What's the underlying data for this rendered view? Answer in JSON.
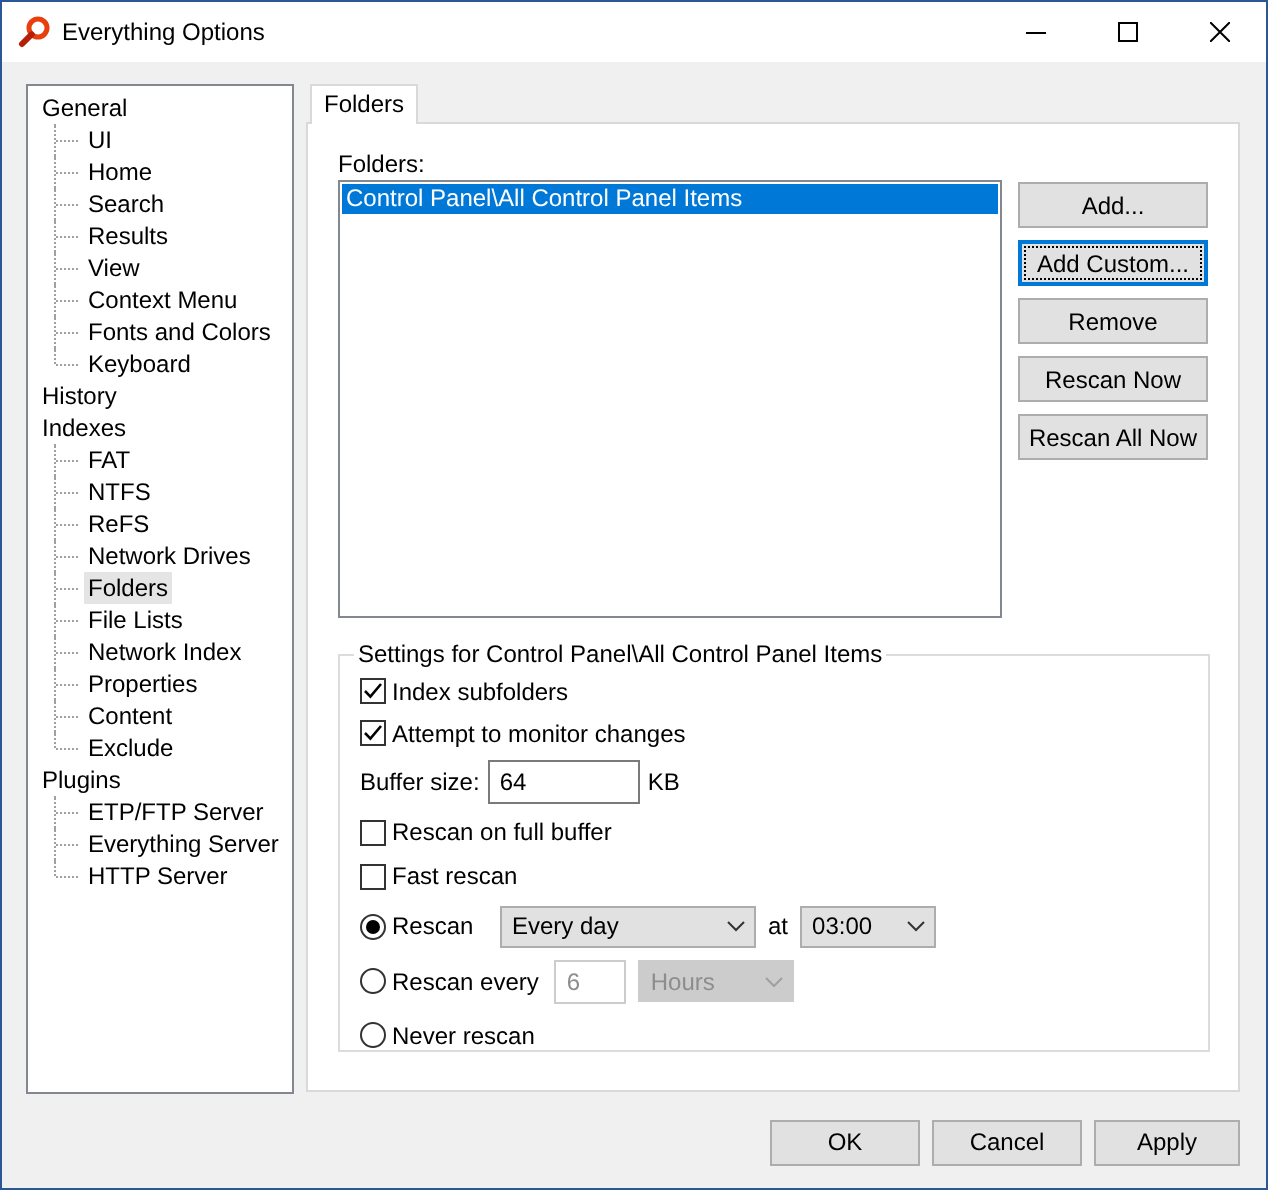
{
  "window": {
    "title": "Everything Options"
  },
  "sidebar": {
    "tree": [
      {
        "label": "General",
        "selected": false,
        "children": [
          {
            "label": "UI",
            "selected": false
          },
          {
            "label": "Home",
            "selected": false
          },
          {
            "label": "Search",
            "selected": false
          },
          {
            "label": "Results",
            "selected": false
          },
          {
            "label": "View",
            "selected": false
          },
          {
            "label": "Context Menu",
            "selected": false
          },
          {
            "label": "Fonts and Colors",
            "selected": false
          },
          {
            "label": "Keyboard",
            "selected": false
          }
        ]
      },
      {
        "label": "History",
        "selected": false
      },
      {
        "label": "Indexes",
        "selected": false,
        "children": [
          {
            "label": "FAT",
            "selected": false
          },
          {
            "label": "NTFS",
            "selected": false
          },
          {
            "label": "ReFS",
            "selected": false
          },
          {
            "label": "Network Drives",
            "selected": false
          },
          {
            "label": "Folders",
            "selected": true
          },
          {
            "label": "File Lists",
            "selected": false
          },
          {
            "label": "Network Index",
            "selected": false
          },
          {
            "label": "Properties",
            "selected": false
          },
          {
            "label": "Content",
            "selected": false
          },
          {
            "label": "Exclude",
            "selected": false
          }
        ]
      },
      {
        "label": "Plugins",
        "selected": false,
        "children": [
          {
            "label": "ETP/FTP Server",
            "selected": false
          },
          {
            "label": "Everything Server",
            "selected": false
          },
          {
            "label": "HTTP Server",
            "selected": false
          }
        ]
      }
    ]
  },
  "tabs": [
    {
      "label": "Folders",
      "selected": true
    }
  ],
  "folders": {
    "label": "Folders:",
    "items": [
      {
        "text": "Control Panel\\All Control Panel Items",
        "selected": true
      }
    ]
  },
  "side_buttons": [
    {
      "label": "Add...",
      "focused": false
    },
    {
      "label": "Add Custom...",
      "focused": true
    },
    {
      "label": "Remove",
      "focused": false
    },
    {
      "label": "Rescan Now",
      "focused": false
    },
    {
      "label": "Rescan All Now",
      "focused": false
    }
  ],
  "settings": {
    "title": "Settings for Control Panel\\All Control Panel Items",
    "rows": [
      {
        "kind": "checkbox",
        "label": "Index subfolders",
        "checked": true
      },
      {
        "kind": "checkbox",
        "label": "Attempt to monitor changes",
        "checked": true
      },
      {
        "kind": "field",
        "label": "Buffer size:",
        "value": "64",
        "unit": "KB"
      },
      {
        "kind": "checkbox",
        "label": "Rescan on full buffer",
        "checked": false
      },
      {
        "kind": "checkbox",
        "label": "Fast rescan",
        "checked": false
      },
      {
        "kind": "radio",
        "label": "Rescan",
        "selected": true,
        "dropdown": "Every day",
        "at": "at",
        "time": "03:00"
      },
      {
        "kind": "radio",
        "label": "Rescan every",
        "selected": false,
        "number": "6",
        "unit": "Hours",
        "disabled": true
      },
      {
        "kind": "radio",
        "label": "Never rescan",
        "selected": false
      }
    ]
  },
  "footer_buttons": [
    "OK",
    "Cancel",
    "Apply"
  ]
}
